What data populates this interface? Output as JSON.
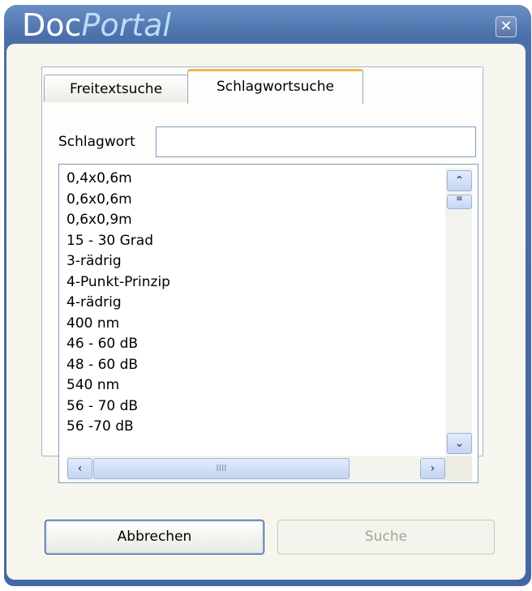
{
  "window": {
    "title_part1": "Doc",
    "title_part2": "Portal",
    "close_glyph": "✕",
    "close_icon": "close-icon",
    "accent_color": "#4a6fa9",
    "tab_highlight_color": "#f4b74a"
  },
  "tabs": [
    {
      "label": "Freitextsuche",
      "active": false
    },
    {
      "label": "Schlagwortsuche",
      "active": true
    }
  ],
  "search": {
    "label": "Schlagwort",
    "value": ""
  },
  "list": {
    "items": [
      "0,4x0,6m",
      "0,6x0,6m",
      "0,6x0,9m",
      "15 - 30 Grad",
      "3-rädrig",
      "4-Punkt-Prinzip",
      "4-rädrig",
      "400 nm",
      "46 - 60 dB",
      "48 - 60 dB",
      "540 nm",
      "56 - 70 dB",
      "56 -70 dB"
    ],
    "scroll": {
      "up_icon": "chevron-up-icon",
      "down_icon": "chevron-down-icon",
      "left_icon": "chevron-left-icon",
      "right_icon": "chevron-right-icon",
      "up_glyph": "⌃",
      "down_glyph": "⌄",
      "left_glyph": "‹",
      "right_glyph": "›",
      "grip_glyph": "IIII",
      "vertical_grip_glyph": "≡"
    }
  },
  "buttons": {
    "cancel_label": "Abbrechen",
    "search_label": "Suche",
    "search_enabled": false
  }
}
